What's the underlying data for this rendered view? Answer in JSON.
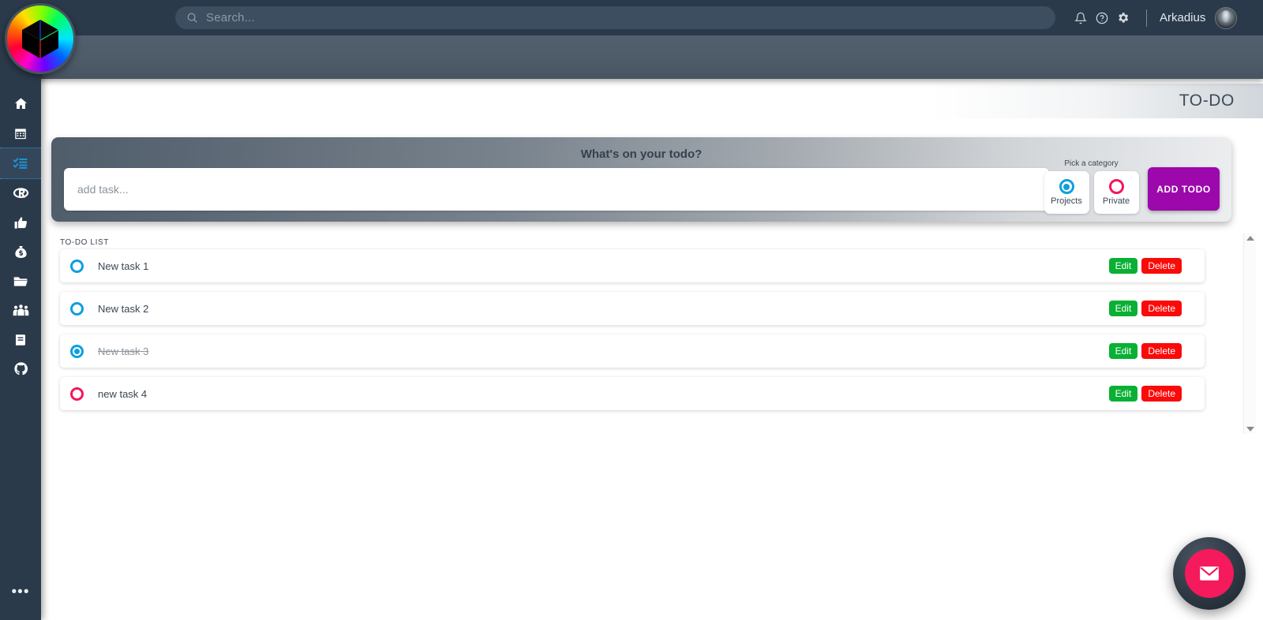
{
  "navbar": {
    "logo_alt": "rainbow-cube-logo",
    "search": {
      "placeholder": "Search...",
      "value": ""
    },
    "icons": [
      "bell-icon",
      "help-circle-icon",
      "gear-icon"
    ],
    "user_name": "Arkadius",
    "avatar_alt": "user-avatar"
  },
  "sidebar": {
    "items": [
      {
        "icon": "home-icon",
        "active": false
      },
      {
        "icon": "calendar-icon",
        "active": false
      },
      {
        "icon": "task-list-icon",
        "active": true
      },
      {
        "icon": "r-logo-icon",
        "active": false
      },
      {
        "icon": "thumbs-up-icon",
        "active": false
      },
      {
        "icon": "money-bag-icon",
        "active": false
      },
      {
        "icon": "folder-open-icon",
        "active": false
      },
      {
        "icon": "users-icon",
        "active": false
      },
      {
        "icon": "book-icon",
        "active": false
      },
      {
        "icon": "github-icon",
        "active": false
      }
    ],
    "more_label": "•••"
  },
  "page": {
    "title": "TO-DO"
  },
  "add_card": {
    "heading": "What's on your todo?",
    "input_placeholder": "add task...",
    "input_value": "",
    "category_label": "Pick a category",
    "categories": [
      {
        "label": "Projects",
        "selected": true,
        "color": "#0d9fe0"
      },
      {
        "label": "Private",
        "selected": false,
        "color": "#f2175b"
      }
    ],
    "submit_label": "ADD TODO",
    "submit_color": "#9c08ab"
  },
  "list": {
    "label": "TO-DO LIST",
    "edit_label": "Edit",
    "delete_label": "Delete",
    "edit_color": "#0ab034",
    "delete_color": "#fb0a0a",
    "tasks": [
      {
        "text": "New task 1",
        "done": false,
        "color": "#0d9fe0"
      },
      {
        "text": "New task 2",
        "done": false,
        "color": "#0d9fe0"
      },
      {
        "text": "New task 3",
        "done": true,
        "color": "#0d9fe0"
      },
      {
        "text": "new task 4",
        "done": false,
        "color": "#f2175b"
      }
    ]
  },
  "fab": {
    "icon": "envelope-icon",
    "color": "#f41a5c"
  }
}
